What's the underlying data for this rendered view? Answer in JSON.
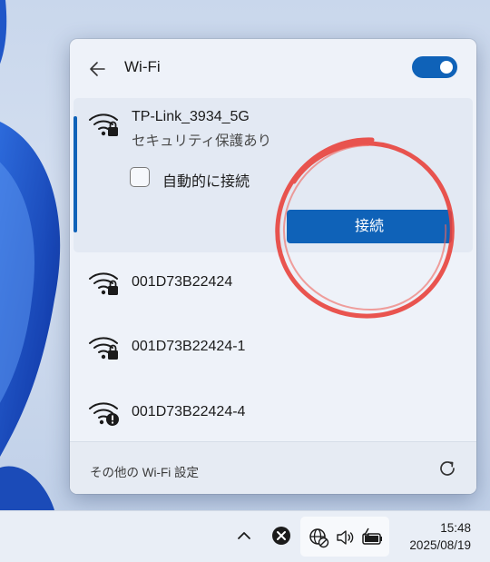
{
  "flyout": {
    "title": "Wi-Fi",
    "wifi_enabled": true,
    "accent_color": "#0f62b8"
  },
  "networks": [
    {
      "ssid": "TP-Link_3934_5G",
      "security": "セキュリティ保護あり",
      "icon": "wifi-secured-icon",
      "expanded": true,
      "auto_connect_label": "自動的に接続",
      "auto_connect_checked": false,
      "connect_label": "接続"
    },
    {
      "ssid": "001D73B22424",
      "icon": "wifi-secured-icon"
    },
    {
      "ssid": "001D73B22424-1",
      "icon": "wifi-secured-icon"
    },
    {
      "ssid": "001D73B22424-4",
      "icon": "wifi-warning-icon"
    }
  ],
  "footer": {
    "more_settings": "その他の Wi-Fi 設定"
  },
  "taskbar": {
    "time": "15:48",
    "date": "2025/08/19"
  },
  "annotation_color": "#e8423c"
}
